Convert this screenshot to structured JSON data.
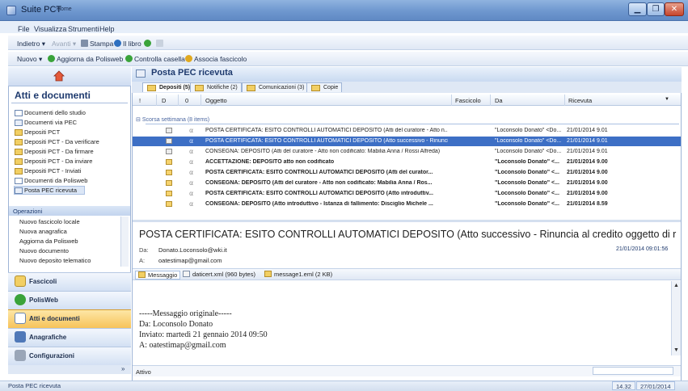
{
  "window": {
    "title": "Suite PCT",
    "controls": {
      "minimize": "▁",
      "maximize": "❐",
      "close": "✕"
    }
  },
  "menu": [
    "File",
    "Visualizza",
    "Strumenti",
    "Help"
  ],
  "toolbar1": {
    "back": "Indietro",
    "forward": "Avanti",
    "print": "Stampa",
    "book": "Il libro"
  },
  "toolbar2": {
    "new": "Nuovo",
    "update": "Aggiorna da Polisweb",
    "check": "Controlla casella",
    "associate": "Associa fascicolo"
  },
  "sidebar": {
    "home": "Home",
    "section_title": "Atti e documenti",
    "tree": [
      "Documenti dello studio",
      "Documenti via PEC",
      "Depositi PCT",
      "Depositi PCT - Da verificare",
      "Depositi PCT - Da firmare",
      "Depositi PCT - Da inviare",
      "Depositi PCT - Inviati",
      "Documenti da Polisweb",
      "Posta PEC ricevuta"
    ],
    "operations_title": "Operazioni",
    "operations": [
      "Nuovo fascicolo locale",
      "Nuova anagrafica",
      "Aggiorna da Polisweb",
      "Nuovo documento",
      "Nuovo deposito telematico"
    ],
    "nav": [
      "Fascicoli",
      "PolisWeb",
      "Atti e documenti",
      "Anagrafiche",
      "Configurazioni"
    ],
    "chevron": "»"
  },
  "main": {
    "title": "Posta PEC ricevuta",
    "tabs": [
      "Depositi (5)",
      "Notifiche (2)",
      "Comunicazioni (3)",
      "Copie"
    ],
    "columns": {
      "flag": "!",
      "doc": "D",
      "att": "0",
      "subject": "Oggetto",
      "dossier": "Fascicolo",
      "from": "Da",
      "received": "Ricevuta"
    },
    "group": "Scorsa settimana (8 items)",
    "rows": [
      {
        "subject": "POSTA CERTIFICATA: ESITO CONTROLLI AUTOMATICI DEPOSITO (Atti del curatore - Atto n...",
        "from": "\"Loconsolo Donato\" <Do...",
        "date": "21/01/2014 9.01"
      },
      {
        "subject": "POSTA CERTIFICATA: ESITO CONTROLLI AUTOMATICI DEPOSITO (Atto successivo - Rinunci...",
        "from": "\"Loconsolo Donato\" <Do...",
        "date": "21/01/2014 9.01"
      },
      {
        "subject": "CONSEGNA: DEPOSITO (Atti del curatore - Atto non codificato: Mabilia Anna / Rossi Alfreda)",
        "from": "\"Loconsolo Donato\" <Do...",
        "date": "21/01/2014 9.01"
      },
      {
        "subject": "ACCETTAZIONE: DEPOSITO atto non codificato",
        "from": "\"Loconsolo Donato\" <...",
        "date": "21/01/2014 9.00"
      },
      {
        "subject": "POSTA CERTIFICATA: ESITO CONTROLLI AUTOMATICI DEPOSITO (Atti del curator...",
        "from": "\"Loconsolo Donato\" <...",
        "date": "21/01/2014 9.00"
      },
      {
        "subject": "CONSEGNA: DEPOSITO (Atti del curatore - Atto non codificato: Mabilia Anna / Ros...",
        "from": "\"Loconsolo Donato\" <...",
        "date": "21/01/2014 9.00"
      },
      {
        "subject": "POSTA CERTIFICATA: ESITO CONTROLLI AUTOMATICI DEPOSITO (Atto introduttiv...",
        "from": "\"Loconsolo Donato\" <...",
        "date": "21/01/2014 9.00"
      },
      {
        "subject": "CONSEGNA: DEPOSITO (Atto introduttivo - Istanza di fallimento: Disciglio Michele ...",
        "from": "\"Loconsolo Donato\" <...",
        "date": "21/01/2014 8.59"
      }
    ]
  },
  "preview": {
    "subject": "POSTA CERTIFICATA: ESITO CONTROLLI AUTOMATICI DEPOSITO (Atto successivo - Rinuncia al credito oggetto di rivendicazi",
    "from_label": "Da:",
    "from": "Donato.Loconsolo@wki.it",
    "to_label": "A:",
    "to": "oatestimap@gmail.com",
    "date": "21/01/2014 09:01:56",
    "attachments": [
      "Messaggio",
      "daticert.xml (960 bytes)",
      "message1.eml (2 KB)"
    ],
    "body": [
      "-----Messaggio originale-----",
      "Da: Loconsolo Donato",
      "Inviato: martedì 21 gennaio 2014 09:50",
      "A: oatestimap@gmail.com"
    ]
  },
  "status": {
    "text": "Posta PEC ricevuta",
    "field_label": "Attivo",
    "time": "14.32",
    "date": "27/01/2014"
  }
}
